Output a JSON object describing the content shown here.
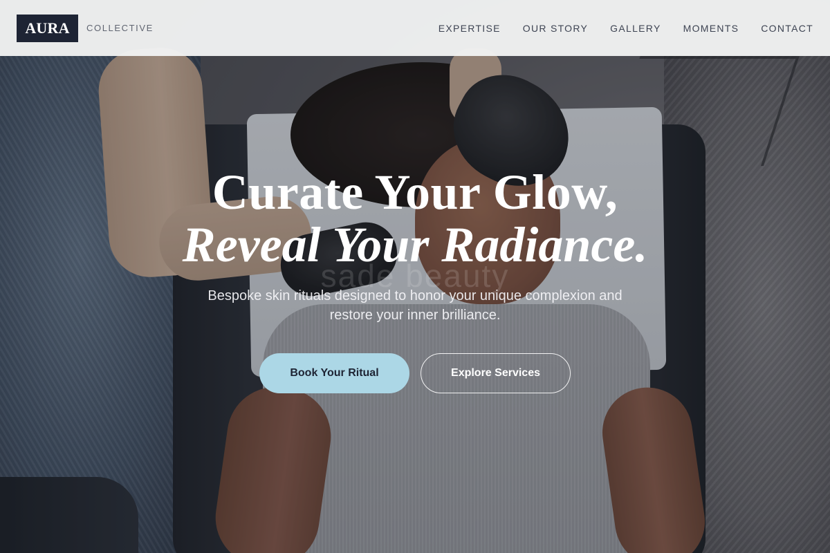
{
  "brand": {
    "logo_text": "AURA",
    "subtitle": "COLLECTIVE"
  },
  "nav": {
    "items": [
      {
        "label": "EXPERTISE"
      },
      {
        "label": "OUR STORY"
      },
      {
        "label": "GALLERY"
      },
      {
        "label": "MOMENTS"
      },
      {
        "label": "CONTACT"
      }
    ]
  },
  "hero": {
    "headline_line1": "Curate Your Glow,",
    "headline_line2": "Reveal Your Radiance.",
    "subtitle": "Bespoke skin rituals designed to honor your unique complexion and restore your inner brilliance.",
    "primary_cta": "Book Your Ritual",
    "secondary_cta": "Explore Services",
    "image_watermark": "sade beauty"
  },
  "colors": {
    "logo_bg": "#1e2434",
    "header_bg": "#f1f2f3",
    "primary_button": "#acd7e6",
    "text_on_dark": "#ffffff"
  }
}
